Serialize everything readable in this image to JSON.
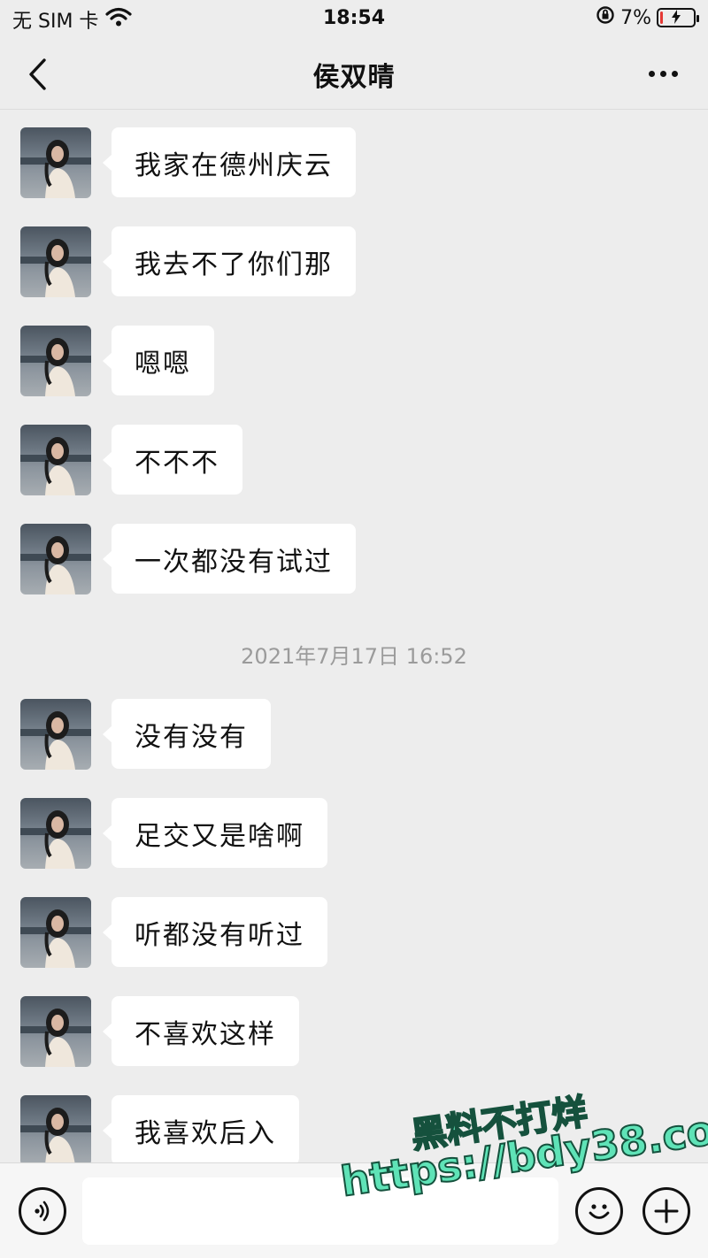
{
  "status_bar": {
    "carrier": "无 SIM 卡",
    "time": "18:54",
    "battery_percent": "7%",
    "battery_level": 0.07,
    "battery_color": "#e53935"
  },
  "header": {
    "title": "侯双晴",
    "back_icon": "chevron-left-icon",
    "more_icon": "more-dots-icon"
  },
  "messages": [
    {
      "text": "我家在德州庆云"
    },
    {
      "text": "我去不了你们那"
    },
    {
      "text": "嗯嗯"
    },
    {
      "text": "不不不"
    },
    {
      "text": "一次都没有试过"
    },
    {
      "text": "没有没有"
    },
    {
      "text": "足交又是啥啊"
    },
    {
      "text": "听都没有听过"
    },
    {
      "text": "不喜欢这样"
    },
    {
      "text": "我喜欢后入"
    }
  ],
  "timestamp": "2021年7月17日 16:52",
  "input_bar": {
    "voice_icon": "voice-icon",
    "input_value": "",
    "emoji_icon": "emoji-icon",
    "plus_icon": "plus-icon"
  },
  "watermark": {
    "line1": "黑料不打烊",
    "line2": "https://bdy38.co"
  },
  "colors": {
    "background": "#ededed",
    "bubble": "#ffffff",
    "timestamp": "#9b9b9b",
    "watermark": "#5fe3b7"
  }
}
